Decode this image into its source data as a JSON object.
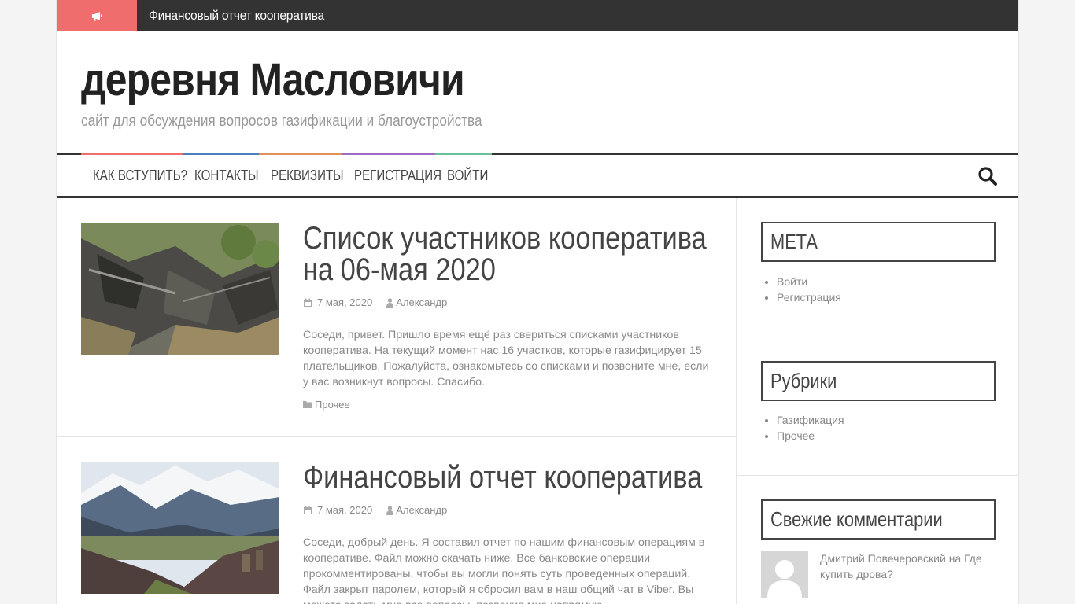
{
  "ticker": {
    "icon": "bullhorn-icon",
    "text": "Финансовый отчет кооператива"
  },
  "branding": {
    "title": "деревня Масловичи",
    "description": "сайт для обсуждения вопросов газификации и благоустройства"
  },
  "nav": {
    "items": [
      {
        "label": "КАК ВСТУПИТЬ?",
        "accent": "#f06d6d"
      },
      {
        "label": "КОНТАКТЫ",
        "accent": "#4a7fc1"
      },
      {
        "label": "РЕКВИЗИТЫ",
        "accent": "#e0905a"
      },
      {
        "label": "РЕГИСТРАЦИЯ",
        "accent": "#9b6bc7"
      },
      {
        "label": "ВОЙТИ",
        "accent": "#6dbf9a"
      }
    ],
    "search_icon": "search-icon"
  },
  "posts": [
    {
      "title": "Список участников кооператива на 06-мая 2020",
      "date": "7 мая, 2020",
      "author": "Александр",
      "excerpt": "Соседи, привет. Пришло время ещё раз свериться списками участников кооператива. На текущий момент нас 16 участков, которые газифицирует 15 плательщиков. Пожалуйста, ознакомьтесь со списками и позвоните мне, если у вас возникнут вопросы. Спасибо.",
      "category": "Прочее"
    },
    {
      "title": "Финансовый отчет кооператива",
      "date": "7 мая, 2020",
      "author": "Александр",
      "excerpt": "Соседи, добрый день. Я составил отчет по нашим финансовым операциям в кооперативе. Файл можно скачать ниже. Все банковские операции прокомментированы, чтобы вы могли понять суть проведенных операций. Файл закрыт паролем, который я сбросил вам в наш общий чат в Viber. Вы можете задать мне все вопросы, позвонив мне напрямую."
    }
  ],
  "sidebar": {
    "meta": {
      "title": "МЕТА",
      "items": [
        "Войти",
        "Регистрация"
      ]
    },
    "categories": {
      "title": "Рубрики",
      "items": [
        "Газификация",
        "Прочее"
      ]
    },
    "comments": {
      "title": "Свежие комментарии",
      "items": [
        {
          "text": "Дмитрий Повечеровский на Где купить дрова?"
        }
      ]
    }
  },
  "colors": {
    "ticker_bg": "#333333",
    "ticker_icon_bg": "#f06d6d"
  }
}
